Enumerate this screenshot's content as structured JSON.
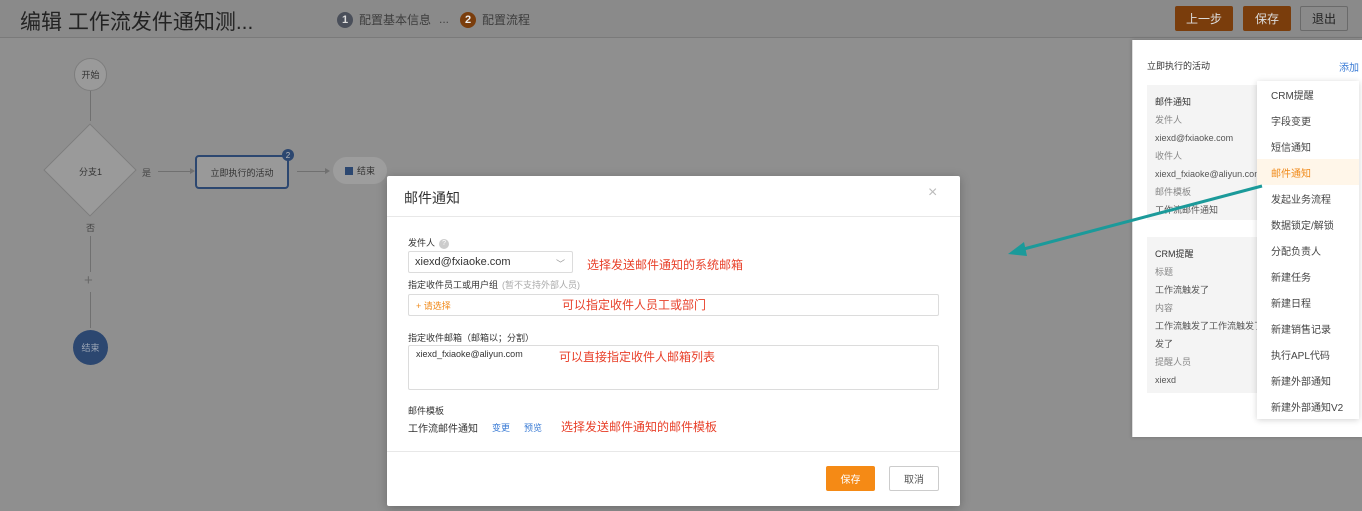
{
  "header": {
    "title": "编辑 工作流发件通知测...",
    "steps": [
      {
        "num": "1",
        "label": "配置基本信息"
      },
      {
        "num": "2",
        "label": "配置流程"
      }
    ],
    "step_separator": "...",
    "prev_label": "上一步",
    "save_label": "保存",
    "exit_label": "退出"
  },
  "canvas": {
    "start_label": "开始",
    "branch_label": "分支1",
    "yes_label": "是",
    "no_label": "否",
    "plus_label": "+",
    "activity_label": "立即执行的活动",
    "activity_badge": "2",
    "end_pill_label": "结束",
    "end_circle_label": "结束"
  },
  "right_panel": {
    "title": "立即执行的活动",
    "add_label": "添加",
    "card1": {
      "lines": [
        "邮件通知",
        "发件人",
        "xiexd@fxiaoke.com",
        "收件人",
        "xiexd_fxiaoke@aliyun.com",
        "邮件模板",
        "工作流邮件通知"
      ]
    },
    "card2": {
      "lines": [
        "CRM提醒",
        "标题",
        "工作流触发了",
        "内容",
        "工作流触发了工作流触发了",
        "发了",
        "提醒人员",
        "xiexd"
      ]
    },
    "menu": [
      "CRM提醒",
      "字段变更",
      "短信通知",
      "邮件通知",
      "发起业务流程",
      "数据锁定/解锁",
      "分配负责人",
      "新建任务",
      "新建日程",
      "新建销售记录",
      "执行APL代码",
      "新建外部通知",
      "新建外部通知V2"
    ],
    "active_menu_index": 3
  },
  "modal": {
    "title": "邮件通知",
    "close_glyph": "×",
    "sender_label": "发件人",
    "help_glyph": "?",
    "sender_value": "xiexd@fxiaoke.com",
    "select_arrow": "﹀",
    "recipients_label": "指定收件员工或用户组",
    "recipients_hint": "(暂不支持外部人员)",
    "recipients_placeholder": "+ 请选择",
    "emails_label": "指定收件邮箱（邮箱以；分割）",
    "emails_value": "xiexd_fxiaoke@aliyun.com",
    "template_label": "邮件模板",
    "template_value": "工作流邮件通知",
    "template_change": "变更",
    "template_preview": "预览",
    "save_label": "保存",
    "cancel_label": "取消",
    "annotations": {
      "sender": "选择发送邮件通知的系统邮箱",
      "recipients": "可以指定收件人员工或部门",
      "emails": "可以直接指定收件人邮箱列表",
      "template": "选择发送邮件通知的邮件模板"
    }
  }
}
